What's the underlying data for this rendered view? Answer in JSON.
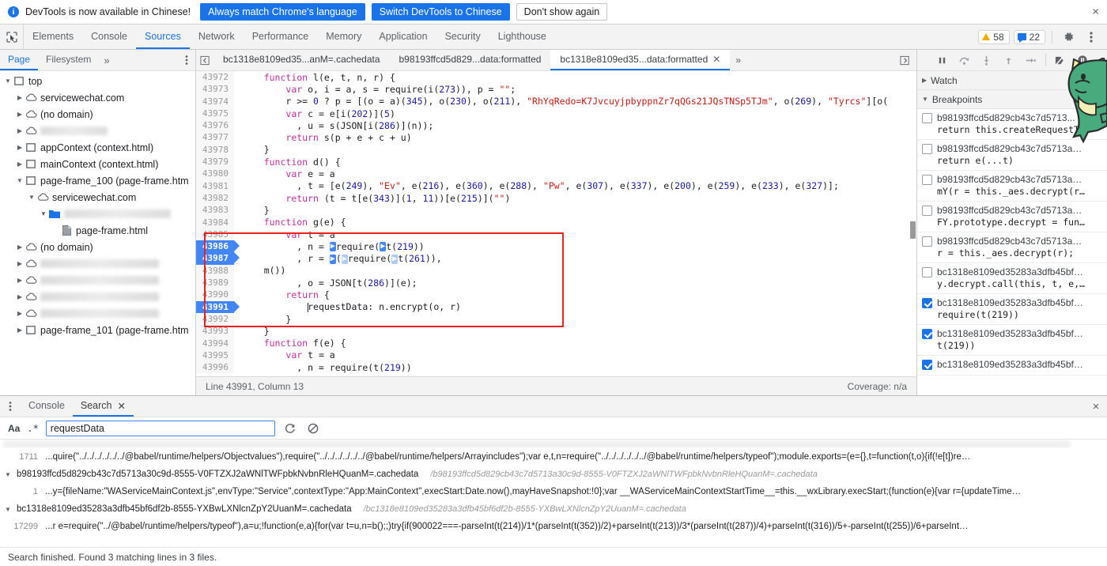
{
  "notice": {
    "icon": "info-icon",
    "message": "DevTools is now available in Chinese!",
    "btn_always": "Always match Chrome's language",
    "btn_switch": "Switch DevTools to Chinese",
    "btn_dismiss": "Don't show again",
    "close": "×"
  },
  "maintabs": {
    "items": [
      {
        "label": "Elements",
        "selected": false
      },
      {
        "label": "Console",
        "selected": false
      },
      {
        "label": "Sources",
        "selected": true
      },
      {
        "label": "Network",
        "selected": false
      },
      {
        "label": "Performance",
        "selected": false
      },
      {
        "label": "Memory",
        "selected": false
      },
      {
        "label": "Application",
        "selected": false
      },
      {
        "label": "Security",
        "selected": false
      },
      {
        "label": "Lighthouse",
        "selected": false
      }
    ],
    "warning_count": "58",
    "message_count": "22"
  },
  "navigator": {
    "tabs": [
      {
        "label": "Page",
        "selected": true
      },
      {
        "label": "Filesystem",
        "selected": false
      }
    ],
    "more": "»",
    "tree": [
      {
        "indent": 0,
        "twisty": "▼",
        "icon": "frame-icon",
        "label": "top",
        "blurred": false
      },
      {
        "indent": 1,
        "twisty": "▶",
        "icon": "cloud-icon",
        "label": "servicewechat.com",
        "blurred": false
      },
      {
        "indent": 1,
        "twisty": "▶",
        "icon": "cloud-icon",
        "label": "(no domain)",
        "blurred": false
      },
      {
        "indent": 1,
        "twisty": "▶",
        "icon": "cloud-icon",
        "label": "",
        "blurred": true,
        "blur_w": 85
      },
      {
        "indent": 1,
        "twisty": "▶",
        "icon": "frame-icon",
        "label": "appContext (context.html)",
        "blurred": false
      },
      {
        "indent": 1,
        "twisty": "▶",
        "icon": "frame-icon",
        "label": "mainContext (context.html)",
        "blurred": false
      },
      {
        "indent": 1,
        "twisty": "▼",
        "icon": "frame-icon",
        "label": "page-frame_100 (page-frame.htm",
        "blurred": false
      },
      {
        "indent": 2,
        "twisty": "▼",
        "icon": "cloud-icon",
        "label": "servicewechat.com",
        "blurred": false
      },
      {
        "indent": 3,
        "twisty": "▼",
        "icon": "folder-icon",
        "label": "",
        "blurred": true,
        "blur_w": 135
      },
      {
        "indent": 4,
        "twisty": "",
        "icon": "file-icon",
        "label": "page-frame.html",
        "blurred": false
      },
      {
        "indent": 1,
        "twisty": "▶",
        "icon": "cloud-icon",
        "label": "(no domain)",
        "blurred": false
      },
      {
        "indent": 1,
        "twisty": "▶",
        "icon": "cloud-icon",
        "label": "",
        "blurred": true,
        "blur_w": 150
      },
      {
        "indent": 1,
        "twisty": "▶",
        "icon": "cloud-icon",
        "label": "",
        "blurred": true,
        "blur_w": 150
      },
      {
        "indent": 1,
        "twisty": "▶",
        "icon": "cloud-icon",
        "label": "",
        "blurred": true,
        "blur_w": 150
      },
      {
        "indent": 1,
        "twisty": "▶",
        "icon": "cloud-icon",
        "label": "",
        "blurred": true,
        "blur_w": 150
      },
      {
        "indent": 1,
        "twisty": "▶",
        "icon": "frame-icon",
        "label": "page-frame_101 (page-frame.htm",
        "blurred": false
      }
    ]
  },
  "editor": {
    "tabs": [
      {
        "label": "bc1318e8109ed35...anM=.cachedata",
        "selected": false,
        "closable": false
      },
      {
        "label": "b98193ffcd5d829...data:formatted",
        "selected": false,
        "closable": false
      },
      {
        "label": "bc1318e8109ed35...data:formatted",
        "selected": true,
        "closable": true
      }
    ],
    "more": "»",
    "status_left": "Line 43991, Column 13",
    "status_right": "Coverage: n/a",
    "lines": [
      {
        "n": "43972",
        "bp": false,
        "html": "    <span class='kw'>function</span> l(e, t, n, r) {"
      },
      {
        "n": "43973",
        "bp": false,
        "html": "        <span class='kw'>var</span> o, i = a, s = require(i(<span class='num'>273</span>)), p = <span class='str'>\"\"</span>;"
      },
      {
        "n": "43974",
        "bp": false,
        "html": "        r &gt;= <span class='num'>0</span> ? p = [(o = a)(<span class='num'>345</span>), o(<span class='num'>230</span>), o(<span class='num'>211</span>), <span class='str'>\"RhYqRedo=K7JvcuyjpbyppnZr7qQGs21JQsTNSp5TJm\"</span>, o(<span class='num'>269</span>), <span class='str'>\"Tyrcs\"</span>][o(</span>"
      },
      {
        "n": "43975",
        "bp": false,
        "html": "        <span class='kw'>var</span> c = e[i(<span class='num'>202</span>)](<span class='num'>5</span>)"
      },
      {
        "n": "43976",
        "bp": false,
        "html": "          , u = s(JSON[i(<span class='num'>286</span>)](n));"
      },
      {
        "n": "43977",
        "bp": false,
        "html": "        <span class='kw'>return</span> s(p + e + c + u)"
      },
      {
        "n": "43978",
        "bp": false,
        "html": "    }"
      },
      {
        "n": "43979",
        "bp": false,
        "html": "    <span class='kw'>function</span> d() {"
      },
      {
        "n": "43980",
        "bp": false,
        "html": "        <span class='kw'>var</span> e = a"
      },
      {
        "n": "43981",
        "bp": false,
        "html": "          , t = [e(<span class='num'>249</span>), <span class='str'>\"Ev\"</span>, e(<span class='num'>216</span>), e(<span class='num'>360</span>), e(<span class='num'>288</span>), <span class='str'>\"Pw\"</span>, e(<span class='num'>307</span>), e(<span class='num'>337</span>), e(<span class='num'>200</span>), e(<span class='num'>259</span>), e(<span class='num'>233</span>), e(<span class='num'>327</span>)];"
      },
      {
        "n": "43982",
        "bp": false,
        "html": "        <span class='kw'>return</span> (t = t[e(<span class='num'>343</span>)](<span class='num'>1</span>, <span class='num'>11</span>))[e(<span class='num'>215</span>)](<span class='str'>\"\"</span>)"
      },
      {
        "n": "43983",
        "bp": false,
        "html": "    }"
      },
      {
        "n": "43984",
        "bp": false,
        "html": "    <span class='kw'>function</span> g(e) {"
      },
      {
        "n": "43985",
        "bp": false,
        "html": "        <span class='kw'>var</span> t = a"
      },
      {
        "n": "43986",
        "bp": true,
        "html": "          , n = <span class='chip'>▶</span>require(<span class='chip'>▶</span>t(<span class='num'>219</span>))"
      },
      {
        "n": "43987",
        "bp": true,
        "html": "          , r = <span class='chip'>▶</span>(<span class='chip lt'>▶</span>require(<span class='chip lt'>▶</span>t(<span class='num'>261</span>)),"
      },
      {
        "n": "43988",
        "bp": false,
        "html": "    m())"
      },
      {
        "n": "43989",
        "bp": false,
        "html": "          , o = JSON[t(<span class='num'>286</span>)](e);"
      },
      {
        "n": "43990",
        "bp": false,
        "html": "        <span class='kw'>return</span> {"
      },
      {
        "n": "43991",
        "bp": true,
        "html": "            <span class='caret'></span>requestData: n.encrypt(o, r)"
      },
      {
        "n": "43992",
        "bp": false,
        "html": "        }"
      },
      {
        "n": "43993",
        "bp": false,
        "html": "    }"
      },
      {
        "n": "43994",
        "bp": false,
        "html": "    <span class='kw'>function</span> f(e) {"
      },
      {
        "n": "43995",
        "bp": false,
        "html": "        <span class='kw'>var</span> t = a"
      },
      {
        "n": "43996",
        "bp": false,
        "html": "          , n = require(t(<span class='num'>219</span>))"
      }
    ]
  },
  "debugger": {
    "toolbar": [
      {
        "name": "resume-button",
        "glyph": "pause"
      },
      {
        "name": "step-over-button",
        "glyph": "stepover"
      },
      {
        "name": "step-into-button",
        "glyph": "stepinto"
      },
      {
        "name": "step-out-button",
        "glyph": "stepout"
      },
      {
        "name": "step-button",
        "glyph": "step"
      },
      {
        "name": "deactivate-breakpoints-button",
        "glyph": "deactivate"
      },
      {
        "name": "pause-on-exceptions-button",
        "glyph": "pauseex"
      }
    ],
    "sections": [
      {
        "label": "Watch",
        "expanded": false
      },
      {
        "label": "Breakpoints",
        "expanded": true
      }
    ],
    "breakpoints": [
      {
        "checked": false,
        "file": "b98193ffcd5d829cb43c7d5713...",
        "code": "return this.createRequestT…"
      },
      {
        "checked": false,
        "file": "b98193ffcd5d829cb43c7d5713a…",
        "code": "return e(...t)"
      },
      {
        "checked": false,
        "file": "b98193ffcd5d829cb43c7d5713a…",
        "code": "mY(r = this._aes.decrypt(r…"
      },
      {
        "checked": false,
        "file": "b98193ffcd5d829cb43c7d5713a…",
        "code": "FY.prototype.decrypt = fun…"
      },
      {
        "checked": false,
        "file": "b98193ffcd5d829cb43c7d5713a…",
        "code": "r = this._aes.decrypt(r);"
      },
      {
        "checked": false,
        "file": "bc1318e8109ed35283a3dfb45bf…",
        "code": "y.decrypt.call(this, t, e,…"
      },
      {
        "checked": true,
        "file": "bc1318e8109ed35283a3dfb45bf…",
        "code": "require(t(219))"
      },
      {
        "checked": true,
        "file": "bc1318e8109ed35283a3dfb45bf…",
        "code": "t(219))"
      },
      {
        "checked": true,
        "file": "bc1318e8109ed35283a3dfb45bf…",
        "code": ""
      }
    ]
  },
  "drawer": {
    "tabs": [
      {
        "label": "Console",
        "selected": false,
        "closable": false
      },
      {
        "label": "Search",
        "selected": true,
        "closable": true
      }
    ],
    "close": "×",
    "search": {
      "match_case_label": "Aa",
      "regex_label": ".*",
      "value": "requestData",
      "placeholder": "",
      "refresh_icon": "refresh-icon",
      "clear_icon": "clear-icon"
    },
    "results": [
      {
        "file": "",
        "url": "",
        "partial": true,
        "lines": [
          {
            "num": "1711",
            "text": "...quire(\"../../../../../../@babel/runtime/helpers/Objectvalues\"),require(\"../../../../../../@babel/runtime/helpers/Arrayincludes\");var e,t,n=require(\"../../../../../../@babel/runtime/helpers/typeof\");module.exports=(e={},t=function(t,o){if(!e[t])re…"
          }
        ]
      },
      {
        "file": "b98193ffcd5d829cb43c7d5713a30c9d-8555-V0FTZXJ2aWNlTWFpbkNvbnRleHQuanM=.cachedata",
        "url": "/b98193ffcd5d829cb43c7d5713a30c9d-8555-V0FTZXJ2aWNlTWFpbkNvbnRleHQuanM=.cachedata",
        "partial": false,
        "lines": [
          {
            "num": "1",
            "text": "...y={fileName:\"WAServiceMainContext.js\",envType:\"Service\",contextType:\"App:MainContext\",execStart:Date.now(),mayHaveSnapshot:!0};var __WAServiceMainContextStartTime__=this.__wxLibrary.execStart;(function(e){var r={updateTime…"
          }
        ]
      },
      {
        "file": "bc1318e8109ed35283a3dfb45bf6df2b-8555-YXBwLXNlcnZpY2UuanM=.cachedata",
        "url": "/bc1318e8109ed35283a3dfb45bf6df2b-8555-YXBwLXNlcnZpY2UuanM=.cachedata",
        "partial": false,
        "lines": [
          {
            "num": "17299",
            "text": "...r e=require(\"../@babel/runtime/helpers/typeof\"),a=u;!function(e,a){for(var t=u,n=b();;)try{if(900022===-parseInt(t(214))/1*(parseInt(t(352))/2)+parseInt(t(213))/3*(parseInt(t(287))/4)+parseInt(t(316))/5+-parseInt(t(255))/6+parseInt…"
          }
        ]
      }
    ],
    "footer": "Search finished. Found 3 matching lines in 3 files."
  }
}
